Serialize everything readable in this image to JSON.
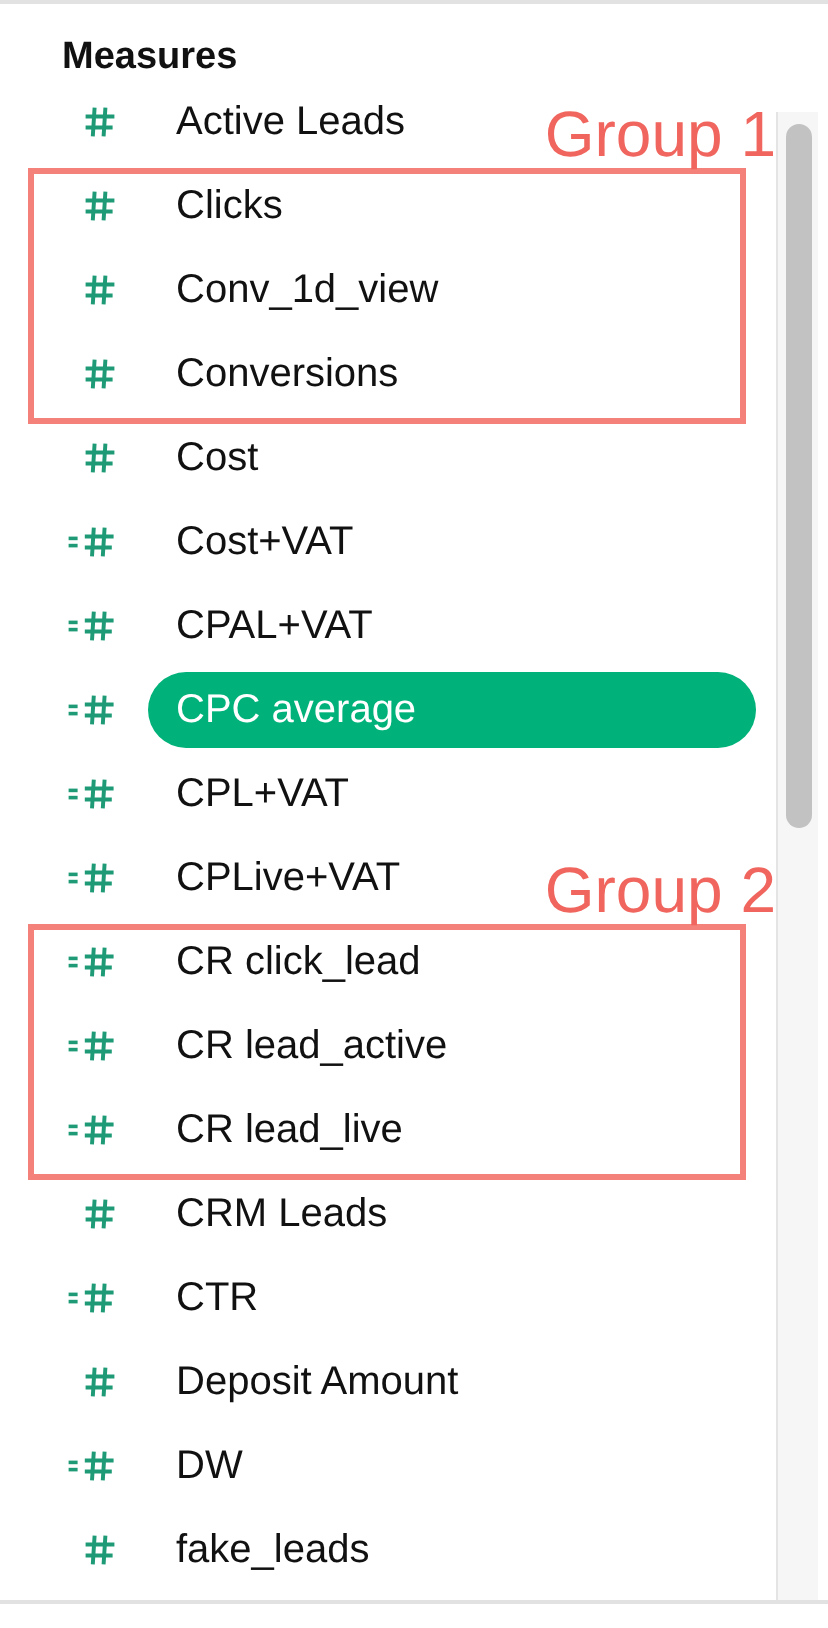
{
  "panel": {
    "title": "Measures"
  },
  "fields": [
    {
      "kind": "measure",
      "label": "Active Leads",
      "selected": false
    },
    {
      "kind": "group",
      "label": "Group 1",
      "items": [
        {
          "kind": "measure",
          "label": "Clicks",
          "selected": false
        },
        {
          "kind": "measure",
          "label": "Conv_1d_view",
          "selected": false
        },
        {
          "kind": "measure",
          "label": "Conversions",
          "selected": false
        }
      ]
    },
    {
      "kind": "measure",
      "label": "Cost",
      "selected": false
    },
    {
      "kind": "calculated",
      "label": "Cost+VAT",
      "selected": false
    },
    {
      "kind": "calculated",
      "label": "CPAL+VAT",
      "selected": false
    },
    {
      "kind": "calculated",
      "label": "CPC average",
      "selected": true
    },
    {
      "kind": "calculated",
      "label": "CPL+VAT",
      "selected": false
    },
    {
      "kind": "calculated",
      "label": "CPLive+VAT",
      "selected": false
    },
    {
      "kind": "group",
      "label": "Group 2",
      "items": [
        {
          "kind": "calculated",
          "label": "CR click_lead",
          "selected": false
        },
        {
          "kind": "calculated",
          "label": "CR lead_active",
          "selected": false
        },
        {
          "kind": "calculated",
          "label": "CR lead_live",
          "selected": false
        }
      ]
    },
    {
      "kind": "measure",
      "label": "CRM Leads",
      "selected": false
    },
    {
      "kind": "calculated",
      "label": "CTR",
      "selected": false
    },
    {
      "kind": "measure",
      "label": "Deposit Amount",
      "selected": false
    },
    {
      "kind": "calculated",
      "label": "DW",
      "selected": false
    },
    {
      "kind": "measure",
      "label": "fake_leads",
      "selected": false
    }
  ]
}
